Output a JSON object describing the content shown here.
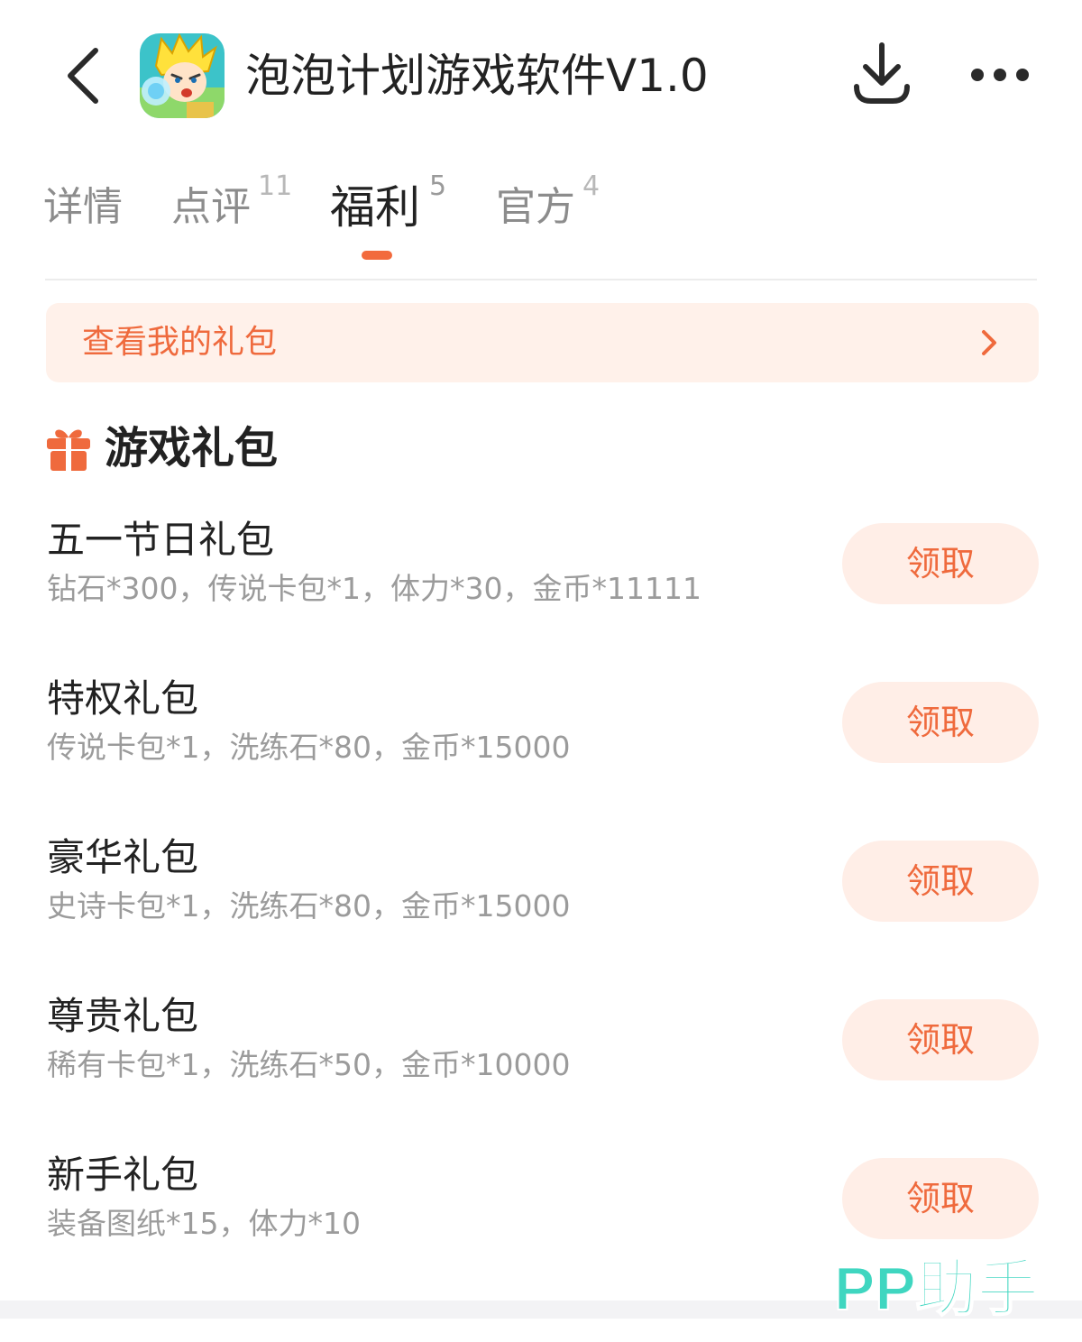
{
  "header": {
    "title": "泡泡计划游戏软件V1.0",
    "back_icon": "chevron-left-icon",
    "download_icon": "download-icon",
    "more_icon": "more-dots-icon"
  },
  "tabs": [
    {
      "label": "详情",
      "count": ""
    },
    {
      "label": "点评",
      "count": "11"
    },
    {
      "label": "福利",
      "count": "5",
      "active": true
    },
    {
      "label": "官方",
      "count": "4"
    }
  ],
  "my_gifts": {
    "label": "查看我的礼包"
  },
  "section": {
    "title": "游戏礼包",
    "icon": "gift-icon"
  },
  "gifts": [
    {
      "name": "五一节日礼包",
      "desc": "钻石*300，传说卡包*1，体力*30，金币*11111",
      "button": "领取"
    },
    {
      "name": "特权礼包",
      "desc": "传说卡包*1，洗练石*80，金币*15000",
      "button": "领取"
    },
    {
      "name": "豪华礼包",
      "desc": "史诗卡包*1，洗练石*80，金币*15000",
      "button": "领取"
    },
    {
      "name": "尊贵礼包",
      "desc": "稀有卡包*1，洗练石*50，金币*10000",
      "button": "领取"
    },
    {
      "name": "新手礼包",
      "desc": "装备图纸*15，体力*10",
      "button": "领取"
    }
  ],
  "watermark": {
    "text": "PP助手"
  },
  "colors": {
    "accent": "#ef6a3d",
    "accent_bg": "#fff1ea",
    "watermark": "#3fd6c0"
  }
}
